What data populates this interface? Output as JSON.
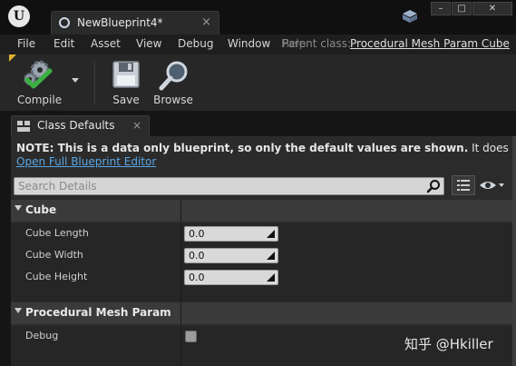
{
  "window": {
    "tab_title": "NewBlueprint4*",
    "close_glyph": "×",
    "controls": {
      "minimize": "–",
      "maximize": "□",
      "close": "✕"
    }
  },
  "menu": {
    "items": [
      "File",
      "Edit",
      "Asset",
      "View",
      "Debug",
      "Window",
      "Help"
    ],
    "parent_class_label": "Parent class:",
    "parent_class_value": "Procedural Mesh Param Cube"
  },
  "toolbar": {
    "compile_label": "Compile",
    "save_label": "Save",
    "browse_label": "Browse",
    "icons": [
      "compile-gear-icon",
      "save-disk-icon",
      "browse-magnifier-icon"
    ]
  },
  "panel": {
    "tab_label": "Class Defaults",
    "note_bold": "NOTE: This is a data only blueprint, so only the default values are shown.",
    "note_rest": "  It does not have any script or",
    "open_full_editor": "Open Full Blueprint Editor",
    "search_placeholder": "Search Details"
  },
  "categories": [
    {
      "name": "Cube",
      "properties": [
        {
          "label": "Cube Length",
          "value": "0.0"
        },
        {
          "label": "Cube Width",
          "value": "0.0"
        },
        {
          "label": "Cube Height",
          "value": "0.0"
        }
      ]
    },
    {
      "name": "Procedural Mesh Param",
      "properties": [
        {
          "label": "Debug",
          "checked": false
        }
      ]
    }
  ],
  "watermark": "知乎 @Hkiller",
  "colors": {
    "link": "#5aa6e6",
    "accent_corner": "#e0b030",
    "compile_check": "#3cb043"
  }
}
